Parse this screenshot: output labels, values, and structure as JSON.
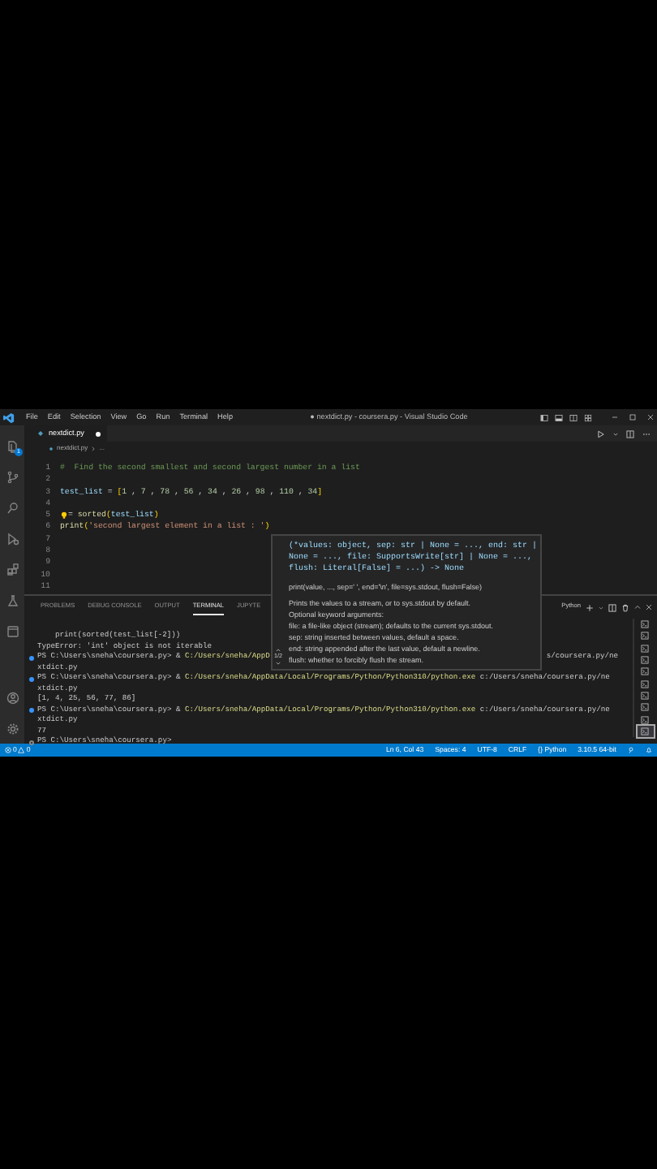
{
  "title_bar": {
    "menu": [
      "File",
      "Edit",
      "Selection",
      "View",
      "Go",
      "Run",
      "Terminal",
      "Help"
    ],
    "title": "● nextdict.py - coursera.py - Visual Studio Code"
  },
  "activity_bar": {
    "items": [
      {
        "kind": "explorer",
        "badge": "1"
      },
      {
        "kind": "source-control"
      },
      {
        "kind": "search"
      },
      {
        "kind": "run"
      },
      {
        "kind": "extensions"
      },
      {
        "kind": "testing"
      },
      {
        "kind": "window"
      }
    ],
    "bottom": [
      {
        "kind": "account"
      },
      {
        "kind": "settings"
      }
    ]
  },
  "editor": {
    "tabs": [
      {
        "label": "nextdict.py",
        "dirty": true,
        "selected": true
      }
    ],
    "breadcrumb": [
      "nextdict.py",
      "..."
    ],
    "lines": [
      {
        "number": "1",
        "tokens": [
          {
            "text": "#  Find the second smallest and second largest number in a list",
            "kind": "comment"
          }
        ]
      },
      {
        "number": "2"
      },
      {
        "number": "3",
        "tokens": [
          {
            "text": "test_list",
            "kind": "variable"
          },
          {
            "text": " = ",
            "kind": "plain"
          },
          {
            "text": "[",
            "kind": "bracket"
          },
          {
            "text": "1",
            "kind": "number"
          },
          {
            "text": " , ",
            "kind": "plain"
          },
          {
            "text": "7",
            "kind": "number"
          },
          {
            "text": " , ",
            "kind": "plain"
          },
          {
            "text": "78",
            "kind": "number"
          },
          {
            "text": " , ",
            "kind": "plain"
          },
          {
            "text": "56",
            "kind": "number"
          },
          {
            "text": " , ",
            "kind": "plain"
          },
          {
            "text": "34",
            "kind": "number"
          },
          {
            "text": " , ",
            "kind": "plain"
          },
          {
            "text": "26",
            "kind": "number"
          },
          {
            "text": " , ",
            "kind": "plain"
          },
          {
            "text": "98",
            "kind": "number"
          },
          {
            "text": " , ",
            "kind": "plain"
          },
          {
            "text": "110",
            "kind": "number"
          },
          {
            "text": " , ",
            "kind": "plain"
          },
          {
            "text": "34",
            "kind": "number"
          },
          {
            "text": "]",
            "kind": "bracket"
          }
        ]
      },
      {
        "number": "4"
      },
      {
        "number": "5",
        "lightbulb": true,
        "tokens": [
          {
            "text": "= ",
            "kind": "plain"
          },
          {
            "text": "sorted",
            "kind": "function"
          },
          {
            "text": "(",
            "kind": "bracket"
          },
          {
            "text": "test_list",
            "kind": "variable"
          },
          {
            "text": ")",
            "kind": "bracket"
          }
        ]
      },
      {
        "number": "6",
        "tokens": [
          {
            "text": "print",
            "kind": "function"
          },
          {
            "text": "(",
            "kind": "bracket"
          },
          {
            "text": "'second largest element in a list : '",
            "kind": "string"
          },
          {
            "text": ")",
            "kind": "bracket"
          }
        ]
      },
      {
        "number": "7"
      },
      {
        "number": "8"
      },
      {
        "number": "9"
      },
      {
        "number": "10"
      },
      {
        "number": "11"
      }
    ]
  },
  "panel": {
    "tabs": [
      {
        "label": "PROBLEMS",
        "selected": false
      },
      {
        "label": "DEBUG CONSOLE",
        "selected": false
      },
      {
        "label": "OUTPUT",
        "selected": false
      },
      {
        "label": "TERMINAL",
        "selected": true
      },
      {
        "label": "JUPYTE",
        "selected": false
      }
    ],
    "terminal_name": "Python",
    "lines": [
      {
        "kind": "output",
        "indent": true,
        "text": "print(sorted(test_list[-2]))"
      },
      {
        "kind": "output",
        "text": "TypeError: 'int' object is not iterable"
      },
      {
        "kind": "command",
        "success": true,
        "prompt": "PS C:\\Users\\sneha\\coursera.py> & ",
        "exe": "C:/Users/sneha/AppD",
        "args": "s/coursera.py/ne",
        "covered": true
      },
      {
        "kind": "output",
        "text": "xtdict.py"
      },
      {
        "kind": "command",
        "success": true,
        "prompt": "PS C:\\Users\\sneha\\coursera.py> & ",
        "exe": "C:/Users/sneha/AppData/Local/Programs/Python/Python310/python.exe",
        "args": "c:/Users/sneha/coursera.py/ne",
        "covered": false
      },
      {
        "kind": "output",
        "text": "xtdict.py"
      },
      {
        "kind": "output",
        "text": "[1, 4, 25, 56, 77, 86]"
      },
      {
        "kind": "command",
        "success": true,
        "prompt": "PS C:\\Users\\sneha\\coursera.py> & ",
        "exe": "C:/Users/sneha/AppData/Local/Programs/Python/Python310/python.exe",
        "args": "c:/Users/sneha/coursera.py/ne",
        "covered": false
      },
      {
        "kind": "output",
        "text": "xtdict.py"
      },
      {
        "kind": "output",
        "text": "77"
      },
      {
        "kind": "command",
        "success": false,
        "prompt": "PS C:\\Users\\sneha\\coursera.py>"
      }
    ],
    "terminals": [
      {
        "selected": false
      },
      {
        "selected": false
      },
      {
        "selected": false
      },
      {
        "selected": false
      },
      {
        "selected": false
      },
      {
        "selected": false
      },
      {
        "selected": false
      },
      {
        "selected": false
      },
      {
        "selected": false
      },
      {
        "selected": true
      }
    ]
  },
  "hover": {
    "pager": "1/2",
    "signature": [
      "(*values: object, sep: str | None = ..., end: str |",
      "None = ..., file: SupportsWrite[str] | None = ...,",
      "flush: Literal[False] = ...) -> None"
    ],
    "doc_signature": "print(value, ..., sep=' ', end='\\n', file=sys.stdout, flush=False)",
    "doc": [
      "Prints the values to a stream, or to sys.stdout by default.",
      "Optional keyword arguments:",
      "file: a file-like object (stream); defaults to the current sys.stdout.",
      "sep: string inserted between values, default a space.",
      "end: string appended after the last value, default a newline.",
      "flush: whether to forcibly flush the stream."
    ]
  },
  "status_bar": {
    "errors": "0",
    "warnings": "0",
    "items": [
      "Ln 6, Col 43",
      "Spaces: 4",
      "UTF-8",
      "CRLF",
      "{} Python",
      "3.10.5 64-bit"
    ]
  }
}
